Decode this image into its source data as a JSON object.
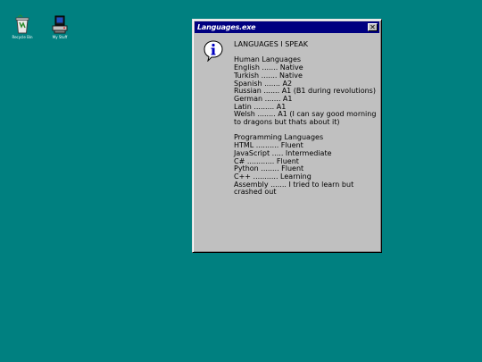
{
  "desktop": {
    "icons": [
      {
        "name": "recycle-bin-icon",
        "label": "Recycle Bin"
      },
      {
        "name": "my-documents-icon",
        "label": "My Stuff"
      }
    ]
  },
  "window": {
    "title": "Languages.exe",
    "close_label": "✕",
    "heading": "LANGUAGES I SPEAK",
    "human_header": "Human Languages",
    "human": [
      "English ....... Native",
      "Turkish ....... Native",
      "Spanish ....... A2",
      "Russian ....... A1 (B1 during revolutions)",
      "German ....... A1",
      "Latin ......... A1",
      "Welsh ........ A1 (I can say good morning to dragons but thats about it)"
    ],
    "prog_header": "Programming Languages",
    "prog": [
      "HTML .......... Fluent",
      "JavaScript ..... Intermediate",
      "C# ............ Fluent",
      "Python ........ Fluent",
      "C++ ........... Learning",
      "Assembly ....... I tried to learn but crashed out"
    ]
  },
  "colors": {
    "desktop": "#008080",
    "titlebar": "#000080",
    "window": "#c0c0c0"
  }
}
